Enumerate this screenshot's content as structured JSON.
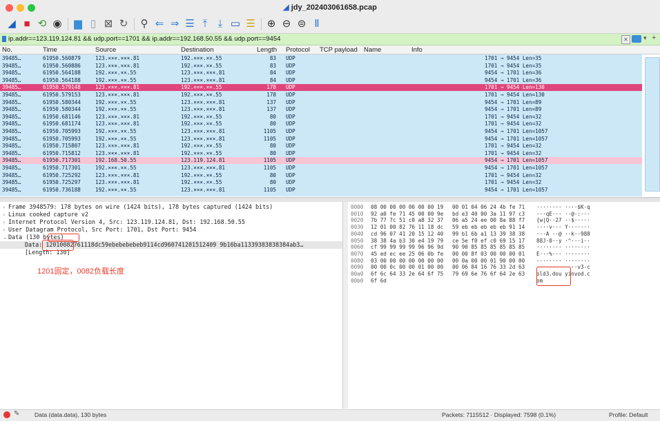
{
  "window": {
    "title": "jdy_202403061658.pcap"
  },
  "filter": {
    "text": "ip.addr==123.119.124.81 && udp.port==1701 && ip.addr==192.168.50.55 && udp.port==9454"
  },
  "columns": [
    "No.",
    "Time",
    "Source",
    "Destination",
    "Length",
    "Protocol",
    "TCP payload",
    "Name",
    "Info"
  ],
  "packets": [
    {
      "no": "39485…",
      "time": "61950.560879",
      "src": "123.×××.×××.81",
      "dst": "192.×××.××.55",
      "len": "83",
      "proto": "UDP",
      "info": "1701 → 9454 Len=35",
      "style": ""
    },
    {
      "no": "39485…",
      "time": "61950.560886",
      "src": "123.×××.×××.81",
      "dst": "192.×××.××.55",
      "len": "83",
      "proto": "UDP",
      "info": "1701 → 9454 Len=35",
      "style": ""
    },
    {
      "no": "39485…",
      "time": "61950.564188",
      "src": "192.×××.××.55",
      "dst": "123.×××.×××.81",
      "len": "84",
      "proto": "UDP",
      "info": "9454 → 1701 Len=36",
      "style": ""
    },
    {
      "no": "39485…",
      "time": "61950.564188",
      "src": "192.×××.××.55",
      "dst": "123.×××.×××.81",
      "len": "84",
      "proto": "UDP",
      "info": "9454 → 1701 Len=36",
      "style": ""
    },
    {
      "no": "39485…",
      "time": "61950.579148",
      "src": "123.×××.×××.81",
      "dst": "192.×××.××.55",
      "len": "178",
      "proto": "UDP",
      "info": "1701 → 9454 Len=130",
      "style": "sel"
    },
    {
      "no": "39485…",
      "time": "61950.579153",
      "src": "123.×××.×××.81",
      "dst": "192.×××.××.55",
      "len": "178",
      "proto": "UDP",
      "info": "1701 → 9454 Len=130",
      "style": ""
    },
    {
      "no": "39485…",
      "time": "61950.580344",
      "src": "192.×××.××.55",
      "dst": "123.×××.×××.81",
      "len": "137",
      "proto": "UDP",
      "info": "9454 → 1701 Len=89",
      "style": ""
    },
    {
      "no": "39485…",
      "time": "61950.580344",
      "src": "192.×××.××.55",
      "dst": "123.×××.×××.81",
      "len": "137",
      "proto": "UDP",
      "info": "9454 → 1701 Len=89",
      "style": ""
    },
    {
      "no": "39485…",
      "time": "61950.681146",
      "src": "123.×××.×××.81",
      "dst": "192.×××.××.55",
      "len": "80",
      "proto": "UDP",
      "info": "1701 → 9454 Len=32",
      "style": ""
    },
    {
      "no": "39485…",
      "time": "61950.681174",
      "src": "123.×××.×××.81",
      "dst": "192.×××.××.55",
      "len": "80",
      "proto": "UDP",
      "info": "1701 → 9454 Len=32",
      "style": ""
    },
    {
      "no": "39485…",
      "time": "61950.705993",
      "src": "192.×××.××.55",
      "dst": "123.×××.×××.81",
      "len": "1105",
      "proto": "UDP",
      "info": "9454 → 1701 Len=1057",
      "style": ""
    },
    {
      "no": "39485…",
      "time": "61950.705993",
      "src": "192.×××.××.55",
      "dst": "123.×××.×××.81",
      "len": "1105",
      "proto": "UDP",
      "info": "9454 → 1701 Len=1057",
      "style": ""
    },
    {
      "no": "39485…",
      "time": "61950.715807",
      "src": "123.×××.×××.81",
      "dst": "192.×××.××.55",
      "len": "80",
      "proto": "UDP",
      "info": "1701 → 9454 Len=32",
      "style": ""
    },
    {
      "no": "39485…",
      "time": "61950.715812",
      "src": "123.×××.×××.81",
      "dst": "192.×××.××.55",
      "len": "80",
      "proto": "UDP",
      "info": "1701 → 9454 Len=32",
      "style": ""
    },
    {
      "no": "39485…",
      "time": "61950.717301",
      "src": "192.168.50.55",
      "dst": "123.119.124.81",
      "len": "1105",
      "proto": "UDP",
      "info": "9454 → 1701 Len=1057",
      "style": "hl"
    },
    {
      "no": "39485…",
      "time": "61950.717301",
      "src": "192.×××.××.55",
      "dst": "123.×××.×××.81",
      "len": "1105",
      "proto": "UDP",
      "info": "9454 → 1701 Len=1057",
      "style": ""
    },
    {
      "no": "39485…",
      "time": "61950.725292",
      "src": "123.×××.×××.81",
      "dst": "192.×××.××.55",
      "len": "80",
      "proto": "UDP",
      "info": "1701 → 9454 Len=32",
      "style": ""
    },
    {
      "no": "39485…",
      "time": "61950.725297",
      "src": "123.×××.×××.81",
      "dst": "192.×××.××.55",
      "len": "80",
      "proto": "UDP",
      "info": "1701 → 9454 Len=32",
      "style": ""
    },
    {
      "no": "39485…",
      "time": "61950.736188",
      "src": "192.×××.××.55",
      "dst": "123.×××.×××.81",
      "len": "1105",
      "proto": "UDP",
      "info": "9454 → 1701 Len=1057",
      "style": ""
    }
  ],
  "details": {
    "frame": "Frame 3948579: 178 bytes on wire (1424 bits), 178 bytes captured (1424 bits)",
    "linux": "Linux cooked capture v2",
    "ip": "Internet Protocol Version 4, Src: 123.119.124.81, Dst: 192.168.50.55",
    "udp": "User Datagram Protocol, Src Port: 1701, Dst Port: 9454",
    "data": "Data (130 bytes)",
    "data_value": "Data: 12010082761118dc59ebebebebeb9114cd960741201512409 9b16ba11339383838384ab3…",
    "length": "[Length: 130]",
    "annotation": "1201固定，0082负载长度"
  },
  "hex_rows": [
    {
      "off": "0000",
      "hex1": "08 00 00 00 00 00 00 19",
      "hex2": "00 01 04 06 24 4b fe 71",
      "ascii": "········ ····$K·q"
    },
    {
      "off": "0010",
      "hex1": "92 a0 fe 71 45 00 00 9e",
      "hex2": "bd e3 40 00 3a 11 97 c3",
      "ascii": "···qE··· ··@·:···"
    },
    {
      "off": "0020",
      "hex1": "7b 77 7c 51 c0 a8 32 37",
      "hex2": "06 a5 24 ee 00 8a 88 f7",
      "ascii": "{w|Q··27 ··$·····"
    },
    {
      "off": "0030",
      "hex1": "12 01 00 82 76 11 18 dc",
      "hex2": "59 eb eb eb eb eb 91 14",
      "ascii": "····v··· Y·······"
    },
    {
      "off": "0040",
      "hex1": "cd 96 07 41 20 15 12 40",
      "hex2": "99 b1 6b a1 13 39 38 38",
      "ascii": "···A ··@ ··k··988"
    },
    {
      "off": "0050",
      "hex1": "38 38 4a b3 30 e4 19 79",
      "hex2": "ce 5e f0 ef c0 69 15 17",
      "ascii": "88J·0··y ·^···i··"
    },
    {
      "off": "0060",
      "hex1": "cf 99 99 99 99 96 96 9d",
      "hex2": "90 90 85 85 85 85 85 85",
      "ascii": "········ ········"
    },
    {
      "off": "0070",
      "hex1": "45 ed ec ee 25 06 0b fe",
      "hex2": "00 00 8f 03 00 00 00 01",
      "ascii": "E···%··· ········"
    },
    {
      "off": "0080",
      "hex1": "03 00 00 00 00 00 00 00",
      "hex2": "00 0a 00 00 01 90 00 00",
      "ascii": "········ ········"
    },
    {
      "off": "0090",
      "hex1": "00 00 0c 00 00 01 00 00",
      "hex2": "00 06 84 16 76 33 2d 63",
      "ascii": "········ ····v3-c"
    },
    {
      "off": "00a0",
      "hex1": "6f 6c 64 33 2e 64 6f 75",
      "hex2": "79 69 6e 76 6f 64 2e 63",
      "ascii": "old3.dou yinvod.c"
    },
    {
      "off": "00b0",
      "hex1": "6f 6d",
      "hex2": "",
      "ascii": "om"
    }
  ],
  "status": {
    "left": "Data (data.data), 130 bytes",
    "packets": "Packets: 7115512 · Displayed: 7598 (0.1%)",
    "profile": "Profile: Default"
  },
  "colors": {
    "selected": "#e0457b",
    "highlight": "#f7c4d4",
    "list_bg": "#cce8f7",
    "filter_ok": "#d4f2c4",
    "annotation": "#e83a2b"
  }
}
